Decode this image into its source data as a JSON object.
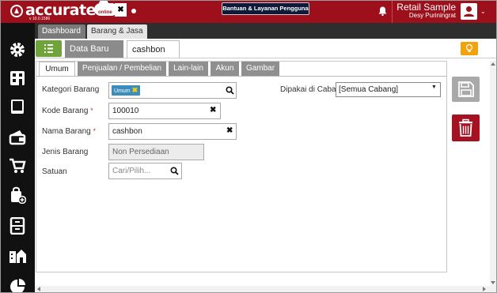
{
  "app": {
    "logo_text": "accurate",
    "logo_sub": "online",
    "version": "v 10.0.1586",
    "help_button": "Bantuan & Layanan Pengguna",
    "company_name": "Retail Sample",
    "user_name": "Desy Puriningrat"
  },
  "sidebar": {
    "items": [
      "settings-icon",
      "building-icon",
      "book-icon",
      "wallet-icon",
      "cart-icon",
      "bag-add-icon",
      "cabinet-icon",
      "city-icon",
      "chart-pie-icon"
    ]
  },
  "top_tabs": {
    "tabs": [
      {
        "label": "Dashboard"
      },
      {
        "label": "Barang & Jasa"
      }
    ],
    "close_label": "✖",
    "count": "2"
  },
  "sub_tabs": {
    "tabs": [
      {
        "label": "Data Baru"
      },
      {
        "label": "cashbon"
      }
    ],
    "close": "✖"
  },
  "inner_tabs": [
    {
      "label": "Umum",
      "active": true
    },
    {
      "label": "Penjualan / Pembelian"
    },
    {
      "label": "Lain-lain"
    },
    {
      "label": "Akun"
    },
    {
      "label": "Gambar"
    }
  ],
  "form": {
    "kategori_label": "Kategori Barang",
    "kategori_tag": "Umum",
    "kode_label": "Kode Barang",
    "kode_value": "100010",
    "nama_label": "Nama Barang",
    "nama_value": "cashbon",
    "jenis_label": "Jenis Barang",
    "jenis_value": "Non Persediaan",
    "satuan_label": "Satuan",
    "satuan_placeholder": "Cari/Pilih...",
    "cabang_label": "Dipakai di Cabang",
    "cabang_value": "[Semua Cabang]",
    "required_mark": "*"
  },
  "colors": {
    "brand": "#9d0f1b",
    "list_button": "#6fa43a",
    "bulb_button": "#f2a20a",
    "delete_button": "#a51322",
    "tag": "#3c8dbc"
  }
}
